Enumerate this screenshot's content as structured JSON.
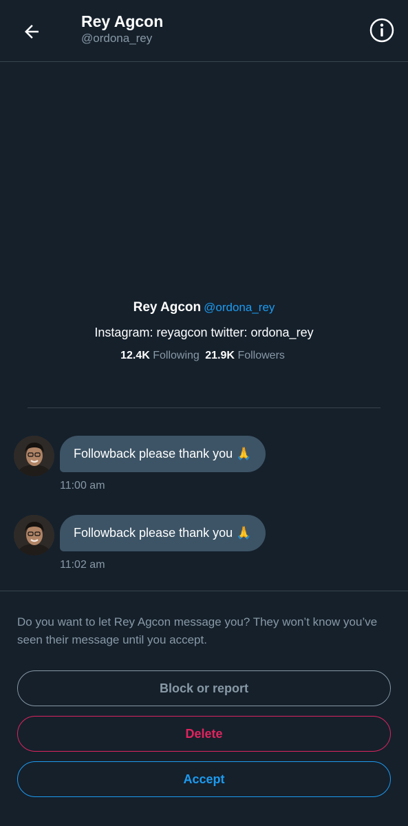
{
  "header": {
    "name": "Rey Agcon",
    "handle": "@ordona_rey"
  },
  "profile": {
    "name": "Rey Agcon",
    "handle": "@ordona_rey",
    "bio": "Instagram: reyagcon twitter: ordona_rey",
    "following_count": "12.4K",
    "following_label": "Following",
    "followers_count": "21.9K",
    "followers_label": "Followers"
  },
  "messages": [
    {
      "text": "Followback please thank you 🙏",
      "time": "11:00 am"
    },
    {
      "text": "Followback please thank you 🙏",
      "time": "11:02 am"
    }
  ],
  "request": {
    "prompt": "Do you want to let Rey Agcon message you? They won’t know you’ve seen their message until you accept.",
    "block_label": "Block or report",
    "delete_label": "Delete",
    "accept_label": "Accept"
  },
  "colors": {
    "background": "#15202b",
    "accent": "#1d9bf0",
    "danger": "#e0245e",
    "bubble": "#3d5466",
    "muted": "#8899a6"
  },
  "icons": [
    "back-arrow-icon",
    "info-icon",
    "avatar"
  ]
}
